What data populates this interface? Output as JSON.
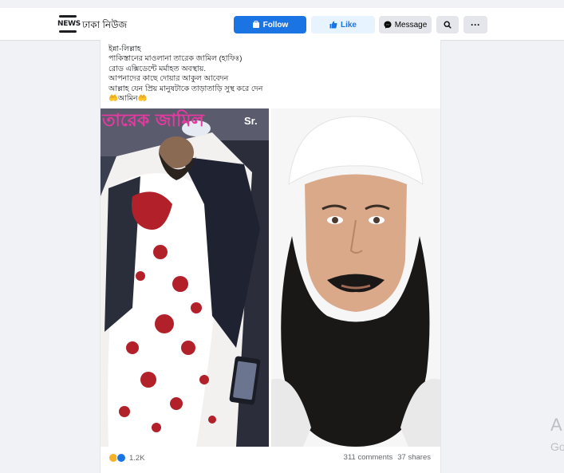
{
  "page": {
    "logo_text": "NEWS",
    "name": "ঢাকা নিউজ",
    "buttons": {
      "follow": "Follow",
      "like": "Like",
      "message": "Message"
    },
    "icons": {
      "follow": "follow-icon",
      "like": "thumbs-up-icon",
      "message": "messenger-icon",
      "search": "search-icon",
      "more": "more-icon"
    },
    "more_label": "···"
  },
  "post": {
    "lines": [
      "ইন্না-লিল্লাহ",
      "পাকিস্তানের মাওলানা তারেক জামিল (হাফিঃ)",
      "রোড এক্সিডেন্টে মর্মাহত অবস্থায়.",
      "আপনাদের কাছে দোয়ার আকুল আবেদন",
      "আল্লাহ যেন প্রিয় মানুষটাকে তাড়াতাড়ি সুস্থ করে দেন",
      "🤲আমিন🤲"
    ],
    "image_overlay_text": "তারেক জামিল",
    "image_overlay_sr": "Sr.",
    "reaction_count": "1.2K",
    "comments": "311 comments",
    "shares": "37 shares"
  },
  "sidebar": {
    "letter_a": "A",
    "letter_g": "Go"
  },
  "colors": {
    "accent": "#1b74e4",
    "like_bg": "#e7f3ff",
    "neutral_btn": "#e4e6eb",
    "overlay_pink": "#e53aa0"
  }
}
